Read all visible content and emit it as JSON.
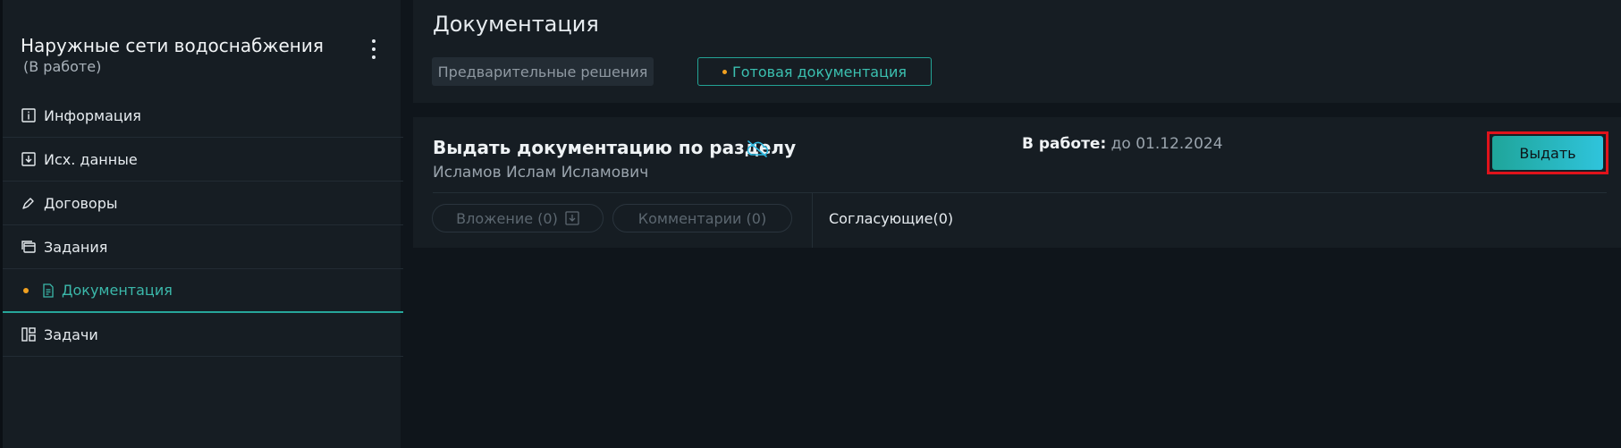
{
  "sidebar": {
    "project_title": "Наружные сети водоснабжения",
    "project_status": "(В работе)",
    "items": [
      {
        "label": "Информация",
        "icon": "info-icon"
      },
      {
        "label": "Исх. данные",
        "icon": "download-box-icon"
      },
      {
        "label": "Договоры",
        "icon": "pen-icon"
      },
      {
        "label": "Задания",
        "icon": "cards-icon"
      },
      {
        "label": "Документация",
        "icon": "document-icon",
        "active": true
      },
      {
        "label": "Задачи",
        "icon": "layout-icon"
      }
    ]
  },
  "header": {
    "title": "Документация",
    "tabs": [
      {
        "label": "Предварительные решения",
        "active": false
      },
      {
        "label": "Готовая документация",
        "active": true
      }
    ]
  },
  "card": {
    "title": "Выдать документацию по разделу",
    "title_icon": "cloud-off-icon",
    "assignee": "Исламов Ислам Исламович",
    "status_label": "В работе:",
    "status_date": "до 01.12.2024",
    "action_label": "Выдать",
    "attachments_label": "Вложение (0)",
    "comments_label": "Комментарии (0)",
    "approvers_label": "Согласующие(0)"
  },
  "colors": {
    "accent": "#26a69a",
    "active_dot": "#f0a020",
    "highlight": "#e0131b",
    "background": "#0f151b",
    "panel": "#161d23"
  }
}
